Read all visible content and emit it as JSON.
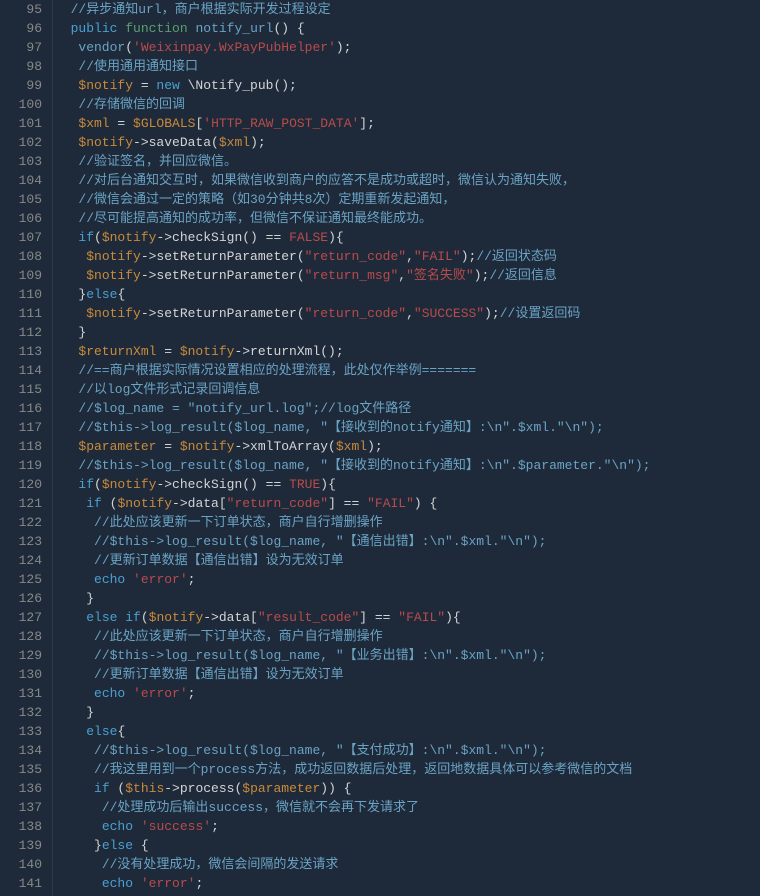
{
  "editor": {
    "startLine": 95,
    "lines": [
      [
        [
          "  ",
          null
        ],
        [
          "//异步通知url，商户根据实际开发过程设定",
          "t-comment"
        ]
      ],
      [
        [
          "  ",
          null
        ],
        [
          "public",
          "t-keyword"
        ],
        [
          " ",
          null
        ],
        [
          "function",
          "t-keyword2"
        ],
        [
          " ",
          null
        ],
        [
          "notify_url",
          "t-func"
        ],
        [
          "() {",
          null
        ]
      ],
      [
        [
          "   ",
          null
        ],
        [
          "vendor",
          "t-func"
        ],
        [
          "(",
          null
        ],
        [
          "'Weixinpay.WxPayPubHelper'",
          "t-string2"
        ],
        [
          ");",
          null
        ]
      ],
      [
        [
          "   ",
          null
        ],
        [
          "//使用通用通知接口",
          "t-comment"
        ]
      ],
      [
        [
          "   ",
          null
        ],
        [
          "$notify",
          "t-var"
        ],
        [
          " = ",
          null
        ],
        [
          "new",
          "t-kw-new"
        ],
        [
          " \\Notify_pub();",
          null
        ]
      ],
      [
        [
          "   ",
          null
        ],
        [
          "//存储微信的回调",
          "t-comment"
        ]
      ],
      [
        [
          "   ",
          null
        ],
        [
          "$xml",
          "t-var"
        ],
        [
          " = ",
          null
        ],
        [
          "$GLOBALS",
          "t-var"
        ],
        [
          "[",
          null
        ],
        [
          "'HTTP_RAW_POST_DATA'",
          "t-string2"
        ],
        [
          "];",
          null
        ]
      ],
      [
        [
          "   ",
          null
        ],
        [
          "$notify",
          "t-var"
        ],
        [
          "->saveData(",
          null
        ],
        [
          "$xml",
          "t-var"
        ],
        [
          ");",
          null
        ]
      ],
      [
        [
          "   ",
          null
        ],
        [
          "//验证签名，并回应微信。",
          "t-comment"
        ]
      ],
      [
        [
          "   ",
          null
        ],
        [
          "//对后台通知交互时，如果微信收到商户的应答不是成功或超时，微信认为通知失败，",
          "t-comment"
        ]
      ],
      [
        [
          "   ",
          null
        ],
        [
          "//微信会通过一定的策略（如30分钟共8次）定期重新发起通知，",
          "t-comment"
        ]
      ],
      [
        [
          "   ",
          null
        ],
        [
          "//尽可能提高通知的成功率，但微信不保证通知最终能成功。",
          "t-comment"
        ]
      ],
      [
        [
          "   ",
          null
        ],
        [
          "if",
          "t-keyword"
        ],
        [
          "(",
          null
        ],
        [
          "$notify",
          "t-var"
        ],
        [
          "->checkSign() == ",
          null
        ],
        [
          "FALSE",
          "t-bool"
        ],
        [
          "){",
          null
        ]
      ],
      [
        [
          "    ",
          null
        ],
        [
          "$notify",
          "t-var"
        ],
        [
          "->setReturnParameter(",
          null
        ],
        [
          "\"return_code\"",
          "t-string2"
        ],
        [
          ",",
          null
        ],
        [
          "\"FAIL\"",
          "t-string2"
        ],
        [
          ");",
          null
        ],
        [
          "//返回状态码",
          "t-comment"
        ]
      ],
      [
        [
          "    ",
          null
        ],
        [
          "$notify",
          "t-var"
        ],
        [
          "->setReturnParameter(",
          null
        ],
        [
          "\"return_msg\"",
          "t-string2"
        ],
        [
          ",",
          null
        ],
        [
          "\"签名失败\"",
          "t-string2"
        ],
        [
          ");",
          null
        ],
        [
          "//返回信息",
          "t-comment"
        ]
      ],
      [
        [
          "   }",
          null
        ],
        [
          "else",
          "t-keyword"
        ],
        [
          "{",
          null
        ]
      ],
      [
        [
          "    ",
          null
        ],
        [
          "$notify",
          "t-var"
        ],
        [
          "->setReturnParameter(",
          null
        ],
        [
          "\"return_code\"",
          "t-string2"
        ],
        [
          ",",
          null
        ],
        [
          "\"SUCCESS\"",
          "t-string2"
        ],
        [
          ");",
          null
        ],
        [
          "//设置返回码",
          "t-comment"
        ]
      ],
      [
        [
          "   }",
          null
        ]
      ],
      [
        [
          "   ",
          null
        ],
        [
          "$returnXml",
          "t-var"
        ],
        [
          " = ",
          null
        ],
        [
          "$notify",
          "t-var"
        ],
        [
          "->returnXml();",
          null
        ]
      ],
      [
        [
          "   ",
          null
        ],
        [
          "//==商户根据实际情况设置相应的处理流程，此处仅作举例=======",
          "t-comment"
        ]
      ],
      [
        [
          "   ",
          null
        ],
        [
          "//以log文件形式记录回调信息",
          "t-comment"
        ]
      ],
      [
        [
          "   ",
          null
        ],
        [
          "//$log_name = \"notify_url.log\";//log文件路径",
          "t-comment"
        ]
      ],
      [
        [
          "   ",
          null
        ],
        [
          "//$this->log_result($log_name, \"【接收到的notify通知】:\\n\".$xml.\"\\n\");",
          "t-comment"
        ]
      ],
      [
        [
          "   ",
          null
        ],
        [
          "$parameter",
          "t-var"
        ],
        [
          " = ",
          null
        ],
        [
          "$notify",
          "t-var"
        ],
        [
          "->xmlToArray(",
          null
        ],
        [
          "$xml",
          "t-var"
        ],
        [
          ");",
          null
        ]
      ],
      [
        [
          "   ",
          null
        ],
        [
          "//$this->log_result($log_name, \"【接收到的notify通知】:\\n\".$parameter.\"\\n\");",
          "t-comment"
        ]
      ],
      [
        [
          "   ",
          null
        ],
        [
          "if",
          "t-keyword"
        ],
        [
          "(",
          null
        ],
        [
          "$notify",
          "t-var"
        ],
        [
          "->checkSign() == ",
          null
        ],
        [
          "TRUE",
          "t-bool"
        ],
        [
          "){",
          null
        ]
      ],
      [
        [
          "    ",
          null
        ],
        [
          "if",
          "t-keyword"
        ],
        [
          " (",
          null
        ],
        [
          "$notify",
          "t-var"
        ],
        [
          "->data[",
          null
        ],
        [
          "\"return_code\"",
          "t-string2"
        ],
        [
          "] == ",
          null
        ],
        [
          "\"FAIL\"",
          "t-string2"
        ],
        [
          ") {",
          null
        ]
      ],
      [
        [
          "     ",
          null
        ],
        [
          "//此处应该更新一下订单状态，商户自行增删操作",
          "t-comment"
        ]
      ],
      [
        [
          "     ",
          null
        ],
        [
          "//$this->log_result($log_name, \"【通信出错】:\\n\".$xml.\"\\n\");",
          "t-comment"
        ]
      ],
      [
        [
          "     ",
          null
        ],
        [
          "//更新订单数据【通信出错】设为无效订单",
          "t-comment"
        ]
      ],
      [
        [
          "     ",
          null
        ],
        [
          "echo",
          "t-keyword"
        ],
        [
          " ",
          null
        ],
        [
          "'error'",
          "t-string2"
        ],
        [
          ";",
          null
        ]
      ],
      [
        [
          "    }",
          null
        ]
      ],
      [
        [
          "    ",
          null
        ],
        [
          "else if",
          "t-keyword"
        ],
        [
          "(",
          null
        ],
        [
          "$notify",
          "t-var"
        ],
        [
          "->data[",
          null
        ],
        [
          "\"result_code\"",
          "t-string2"
        ],
        [
          "] == ",
          null
        ],
        [
          "\"FAIL\"",
          "t-string2"
        ],
        [
          "){",
          null
        ]
      ],
      [
        [
          "     ",
          null
        ],
        [
          "//此处应该更新一下订单状态，商户自行增删操作",
          "t-comment"
        ]
      ],
      [
        [
          "     ",
          null
        ],
        [
          "//$this->log_result($log_name, \"【业务出错】:\\n\".$xml.\"\\n\");",
          "t-comment"
        ]
      ],
      [
        [
          "     ",
          null
        ],
        [
          "//更新订单数据【通信出错】设为无效订单",
          "t-comment"
        ]
      ],
      [
        [
          "     ",
          null
        ],
        [
          "echo",
          "t-keyword"
        ],
        [
          " ",
          null
        ],
        [
          "'error'",
          "t-string2"
        ],
        [
          ";",
          null
        ]
      ],
      [
        [
          "    }",
          null
        ]
      ],
      [
        [
          "    ",
          null
        ],
        [
          "else",
          "t-keyword"
        ],
        [
          "{",
          null
        ]
      ],
      [
        [
          "     ",
          null
        ],
        [
          "//$this->log_result($log_name, \"【支付成功】:\\n\".$xml.\"\\n\");",
          "t-comment"
        ]
      ],
      [
        [
          "     ",
          null
        ],
        [
          "//我这里用到一个process方法，成功返回数据后处理，返回地数据具体可以参考微信的文档",
          "t-comment"
        ]
      ],
      [
        [
          "     ",
          null
        ],
        [
          "if",
          "t-keyword"
        ],
        [
          " (",
          null
        ],
        [
          "$this",
          "t-var"
        ],
        [
          "->process(",
          null
        ],
        [
          "$parameter",
          "t-var"
        ],
        [
          ")) {",
          null
        ]
      ],
      [
        [
          "      ",
          null
        ],
        [
          "//处理成功后输出success，微信就不会再下发请求了",
          "t-comment"
        ]
      ],
      [
        [
          "      ",
          null
        ],
        [
          "echo",
          "t-keyword"
        ],
        [
          " ",
          null
        ],
        [
          "'success'",
          "t-string2"
        ],
        [
          ";",
          null
        ]
      ],
      [
        [
          "     }",
          null
        ],
        [
          "else",
          "t-keyword"
        ],
        [
          " {",
          null
        ]
      ],
      [
        [
          "      ",
          null
        ],
        [
          "//没有处理成功，微信会间隔的发送请求",
          "t-comment"
        ]
      ],
      [
        [
          "      ",
          null
        ],
        [
          "echo",
          "t-keyword"
        ],
        [
          " ",
          null
        ],
        [
          "'error'",
          "t-string2"
        ],
        [
          ";",
          null
        ]
      ]
    ]
  }
}
